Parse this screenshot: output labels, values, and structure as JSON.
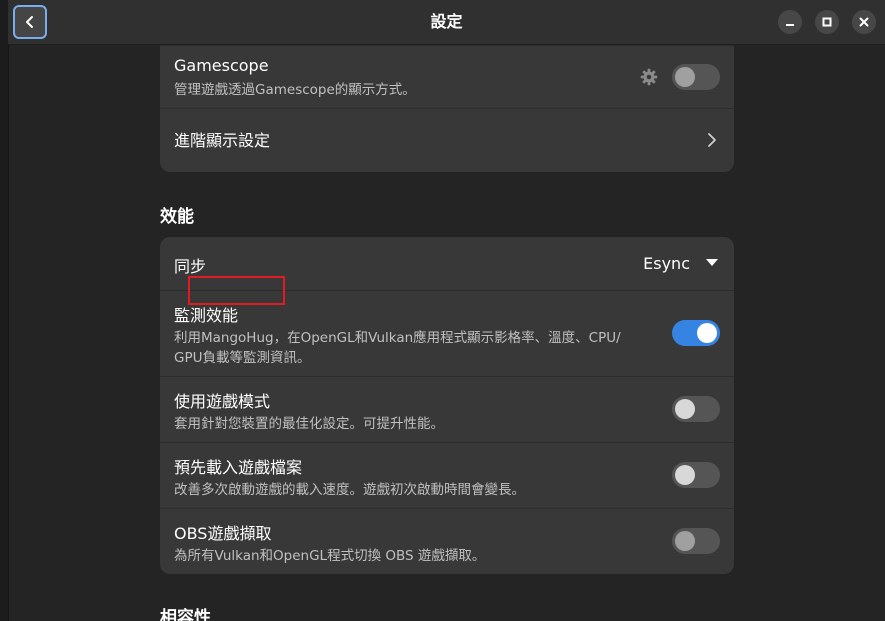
{
  "window": {
    "title": "設定",
    "back_icon": "chevron-left-icon",
    "minimize_icon": "minimize-icon",
    "maximize_icon": "maximize-icon",
    "close_icon": "close-icon"
  },
  "display_group": {
    "rows": [
      {
        "title": "Gamescope",
        "subtitle": "管理遊戲透過Gamescope的顯示方式。",
        "icon": "gear-icon",
        "toggle_on": false
      },
      {
        "title": "進階顯示設定",
        "icon": "chevron-right-icon"
      }
    ]
  },
  "performance": {
    "heading": "效能",
    "sync": {
      "title": "同步",
      "value": "Esync",
      "icon": "dropdown-arrow-icon"
    },
    "monitor": {
      "title": "監測效能",
      "subtitle_line1": "利用MangoHug，在OpenGL和Vulkan應用程式顯示影格率、溫度、CPU/",
      "subtitle_line2": "GPU負載等監測資訊。",
      "toggle_on": true
    },
    "game_mode": {
      "title": "使用遊戲模式",
      "subtitle": "套用針對您裝置的最佳化設定。可提升性能。",
      "toggle_on": false
    },
    "preload": {
      "title": "預先載入遊戲檔案",
      "subtitle": "改善多次啟動遊戲的載入速度。遊戲初次啟動時間會變長。",
      "toggle_on": false
    },
    "obs": {
      "title": "OBS遊戲擷取",
      "subtitle": "為所有Vulkan和OpenGL程式切換 OBS 遊戲擷取。",
      "toggle_on": false
    }
  },
  "compatibility": {
    "heading": "相容性"
  },
  "colors": {
    "accent": "#3584e4",
    "highlight": "#e01b24",
    "background": "#242424",
    "card": "#383838"
  }
}
